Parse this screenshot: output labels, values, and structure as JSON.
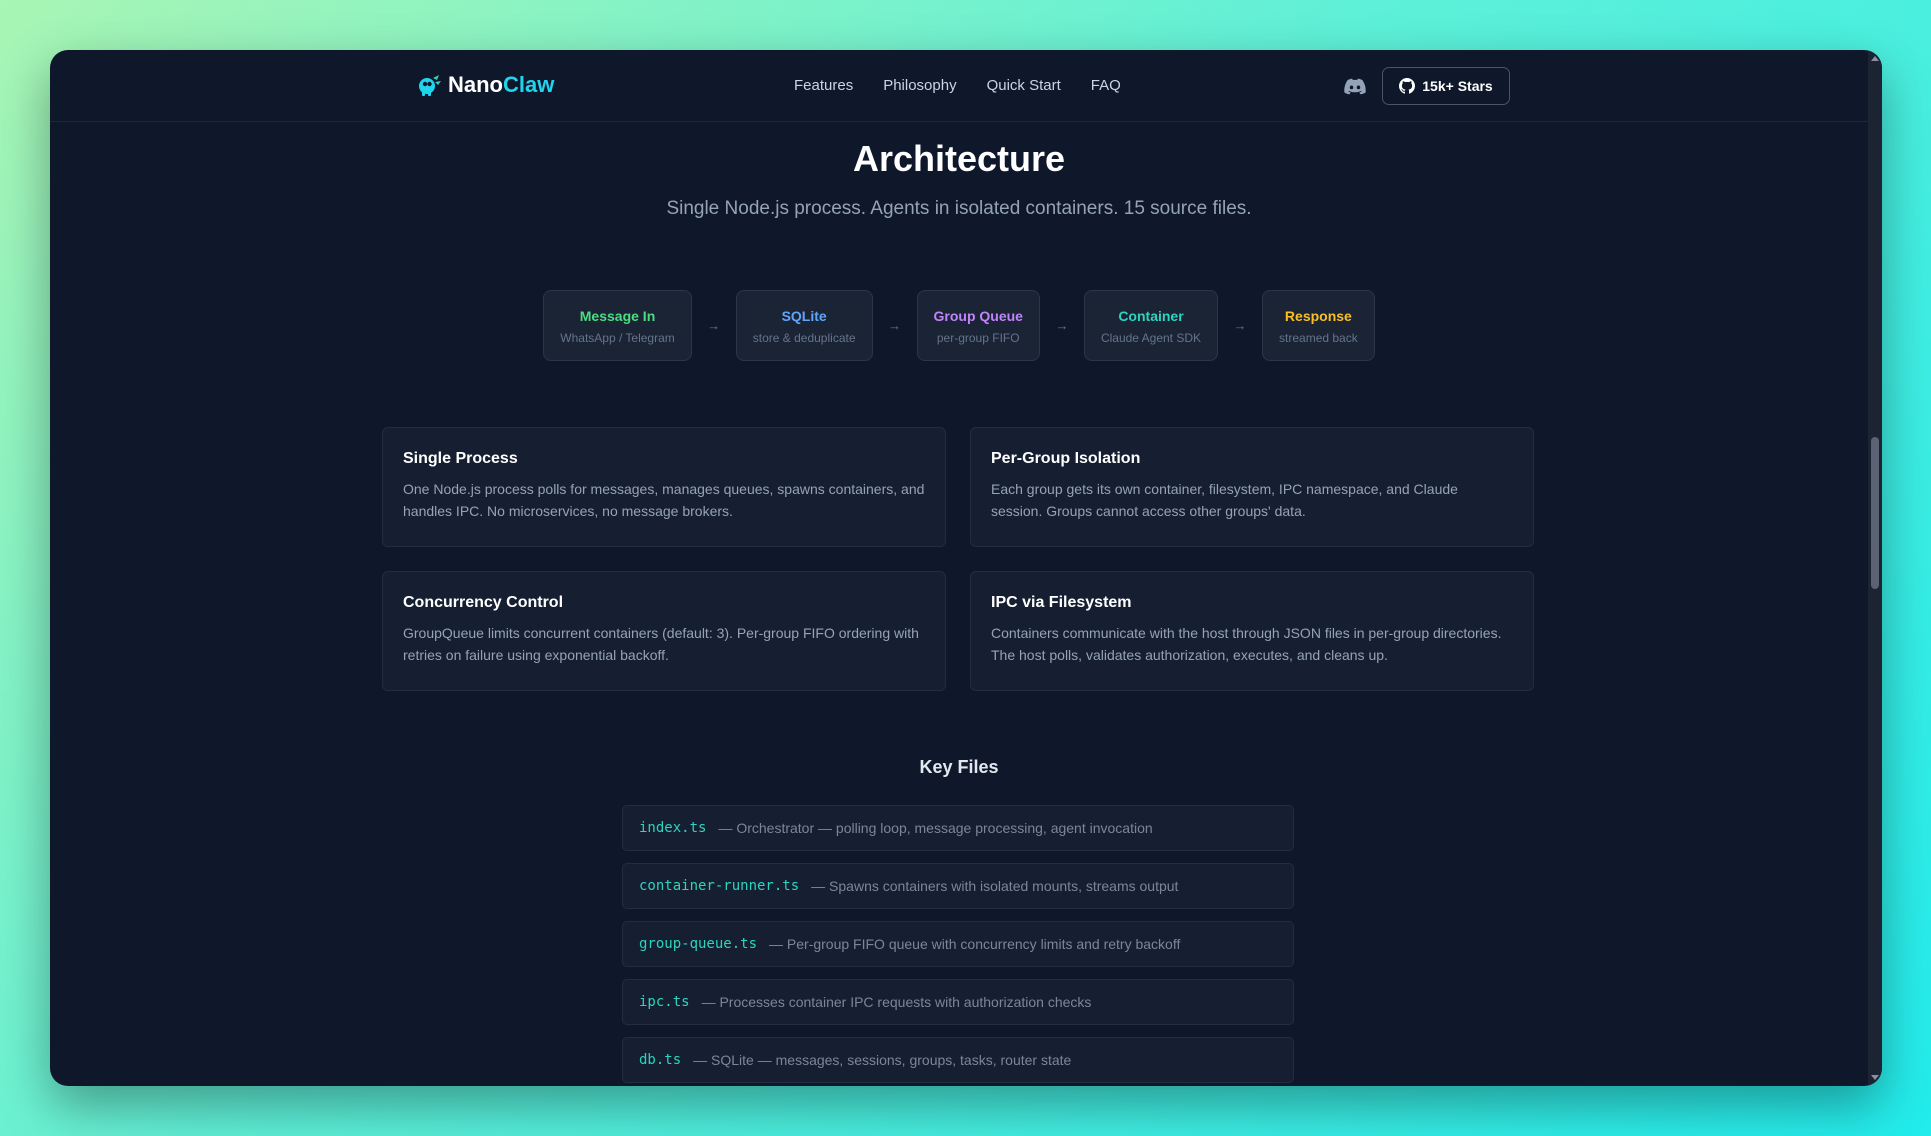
{
  "nav": {
    "logo_part1": "Nano",
    "logo_part2": "Claw",
    "links": [
      "Features",
      "Philosophy",
      "Quick Start",
      "FAQ"
    ],
    "stars_label": "15k+ Stars"
  },
  "hero": {
    "title": "Architecture",
    "subtitle": "Single Node.js process. Agents in isolated containers. 15 source files."
  },
  "flow": [
    {
      "name": "Message In",
      "desc": "WhatsApp / Telegram",
      "color": "#4ade80"
    },
    {
      "name": "SQLite",
      "desc": "store & deduplicate",
      "color": "#60a5fa"
    },
    {
      "name": "Group Queue",
      "desc": "per-group FIFO",
      "color": "#c084fc"
    },
    {
      "name": "Container",
      "desc": "Claude Agent SDK",
      "color": "#2dd4bf"
    },
    {
      "name": "Response",
      "desc": "streamed back",
      "color": "#fbbf24"
    }
  ],
  "flow_arrow": "→",
  "cards": [
    {
      "title": "Single Process",
      "body": "One Node.js process polls for messages, manages queues, spawns containers, and handles IPC. No microservices, no message brokers."
    },
    {
      "title": "Per-Group Isolation",
      "body": "Each group gets its own container, filesystem, IPC namespace, and Claude session. Groups cannot access other groups' data."
    },
    {
      "title": "Concurrency Control",
      "body": "GroupQueue limits concurrent containers (default: 3). Per-group FIFO ordering with retries on failure using exponential backoff."
    },
    {
      "title": "IPC via Filesystem",
      "body": "Containers communicate with the host through JSON files in per-group directories. The host polls, validates authorization, executes, and cleans up."
    }
  ],
  "key_files": {
    "title": "Key Files",
    "files": [
      {
        "name": "index.ts",
        "desc": "— Orchestrator — polling loop, message processing, agent invocation"
      },
      {
        "name": "container-runner.ts",
        "desc": "— Spawns containers with isolated mounts, streams output"
      },
      {
        "name": "group-queue.ts",
        "desc": "— Per-group FIFO queue with concurrency limits and retry backoff"
      },
      {
        "name": "ipc.ts",
        "desc": "— Processes container IPC requests with authorization checks"
      },
      {
        "name": "db.ts",
        "desc": "— SQLite — messages, sessions, groups, tasks, router state"
      }
    ]
  },
  "icons": {
    "logo": "nanoclaw-logo-icon",
    "discord": "discord-icon",
    "github": "github-icon"
  }
}
